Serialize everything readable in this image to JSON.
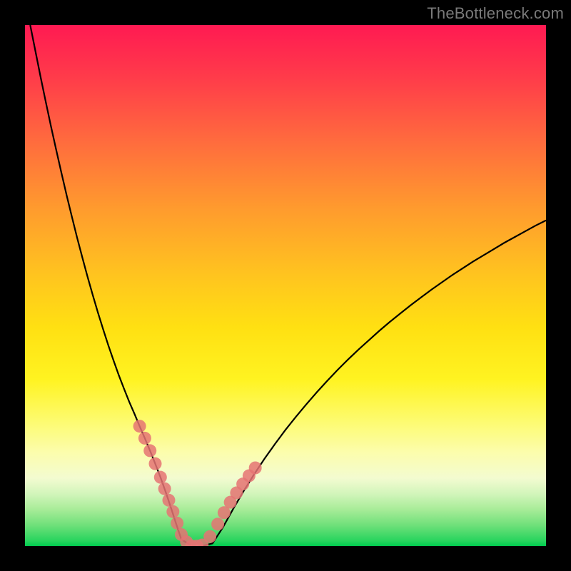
{
  "watermark": {
    "text": "TheBottleneck.com"
  },
  "chart_data": {
    "type": "line",
    "title": "",
    "xlabel": "",
    "ylabel": "",
    "xlim": [
      0,
      100
    ],
    "ylim": [
      0,
      100
    ],
    "grid": false,
    "gradient_stops": [
      {
        "pos": 0,
        "color": "#ff1a52"
      },
      {
        "pos": 50,
        "color": "#ffd21b"
      },
      {
        "pos": 85,
        "color": "#fcfdac"
      },
      {
        "pos": 100,
        "color": "#00cc4f"
      }
    ],
    "series": [
      {
        "name": "curve",
        "color": "#000000",
        "x": [
          1,
          2,
          3,
          4,
          5,
          6,
          7,
          8,
          9,
          10,
          11,
          12,
          13,
          14,
          15,
          16,
          17,
          18,
          19,
          20,
          21,
          22,
          23,
          24,
          25,
          26,
          27,
          28,
          29,
          30,
          32,
          34,
          36,
          38,
          40,
          42,
          44,
          46,
          48,
          50,
          52,
          54,
          56,
          58,
          60,
          62,
          64,
          66,
          68,
          70,
          72,
          74,
          76,
          78,
          80,
          82,
          84,
          86,
          88,
          90,
          92,
          94,
          96,
          98,
          100
        ],
        "y": [
          100,
          95,
          90,
          85.2,
          80.5,
          76,
          71.6,
          67.3,
          63.2,
          59.2,
          55.4,
          51.7,
          48.2,
          44.8,
          41.6,
          38.5,
          35.6,
          32.8,
          30.2,
          27.7,
          25.4,
          23,
          20.7,
          18.3,
          15.8,
          13.2,
          10.4,
          7.4,
          4.3,
          1.3,
          0,
          0,
          0.5,
          3.6,
          7.2,
          10.6,
          13.8,
          16.8,
          19.6,
          22.3,
          24.8,
          27.2,
          29.5,
          31.7,
          33.8,
          35.8,
          37.7,
          39.5,
          41.3,
          43,
          44.6,
          46.2,
          47.7,
          49.2,
          50.6,
          52,
          53.3,
          54.6,
          55.8,
          57,
          58.2,
          59.3,
          60.4,
          61.5,
          62.5
        ]
      },
      {
        "name": "markers",
        "type": "scatter",
        "color": "#e57373",
        "radius": 9,
        "x": [
          22,
          23,
          24,
          25,
          26,
          26.8,
          27.6,
          28.4,
          29.2,
          30,
          31,
          32,
          33,
          34,
          35.5,
          37,
          38.2,
          39.4,
          40.6,
          41.8,
          43,
          44.2
        ],
        "y": [
          23,
          20.7,
          18.3,
          15.8,
          13.2,
          11,
          8.8,
          6.6,
          4.4,
          2.2,
          0.8,
          0,
          0,
          0.2,
          1.8,
          4.2,
          6.4,
          8.4,
          10.2,
          11.9,
          13.5,
          15
        ]
      }
    ]
  }
}
